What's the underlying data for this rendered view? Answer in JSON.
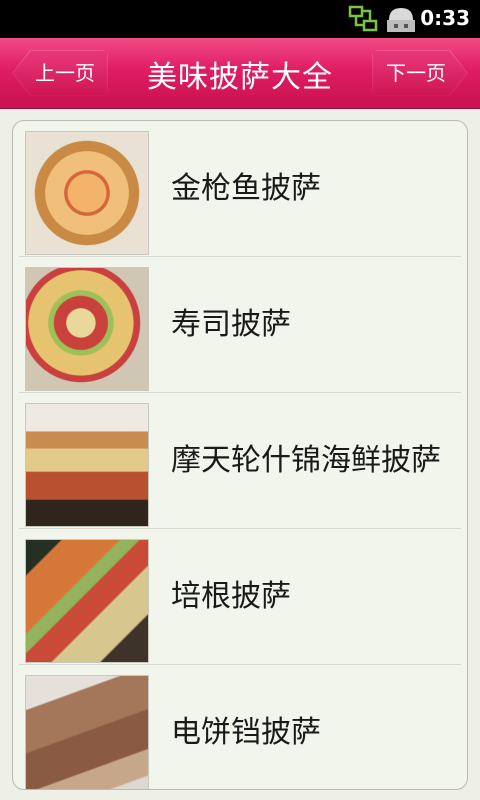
{
  "status_bar": {
    "time": "0:33",
    "icons": [
      "network-sync-icon",
      "usb-debug-icon"
    ]
  },
  "title_bar": {
    "title": "美味披萨大全",
    "prev_label": "上一页",
    "next_label": "下一页",
    "accent_color": "#e01d63"
  },
  "list": {
    "items": [
      {
        "label": "金枪鱼披萨",
        "image": "pizza-photo"
      },
      {
        "label": "寿司披萨",
        "image": "pizza-photo"
      },
      {
        "label": "摩天轮什锦海鲜披萨",
        "image": "pizza-photo"
      },
      {
        "label": "培根披萨",
        "image": "pizza-photo"
      },
      {
        "label": "电饼铛披萨",
        "image": "pizza-photo"
      }
    ]
  }
}
